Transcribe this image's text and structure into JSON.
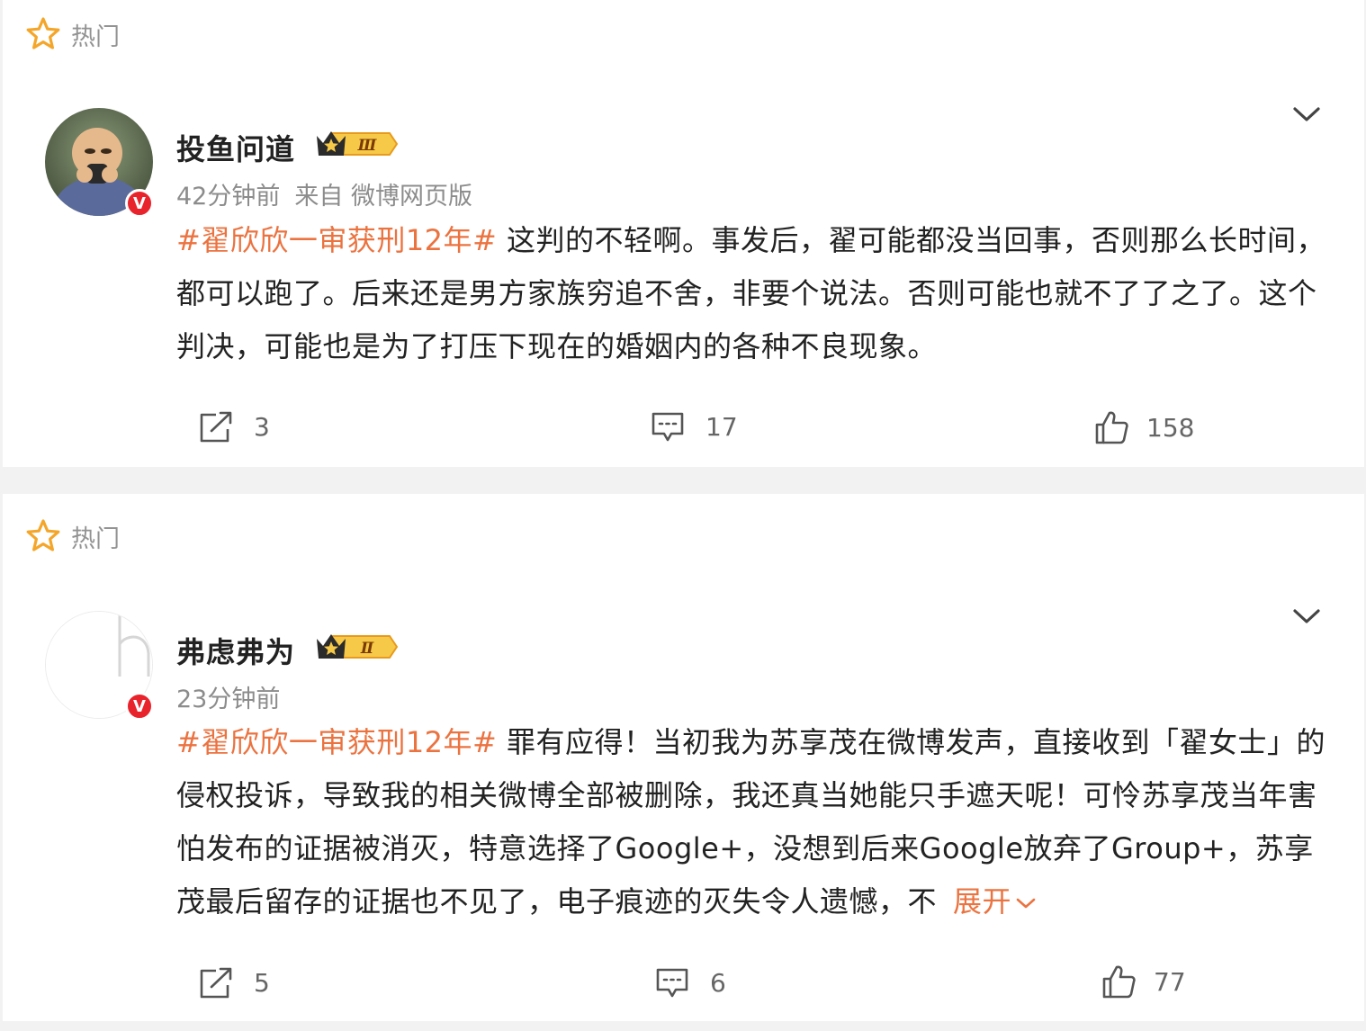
{
  "posts": [
    {
      "hot_label": "热门",
      "username": "投鱼问道",
      "rank": "Ⅲ",
      "time": "42分钟前",
      "source": "来自 微博网页版",
      "topic": "#翟欣欣一审获刑12年#",
      "body": " 这判的不轻啊。事发后，翟可能都没当回事，否则那么长时间，都可以跑了。后来还是男方家族穷追不舍，非要个说法。否则可能也就不了了之了。这个判决，可能也是为了打压下现在的婚姻内的各种不良现象。",
      "expand": "",
      "reposts": "3",
      "comments": "17",
      "likes": "158"
    },
    {
      "hot_label": "热门",
      "username": "弗虑弗为",
      "rank": "Ⅱ",
      "time": "23分钟前",
      "source": "",
      "topic": "#翟欣欣一审获刑12年#",
      "body": " 罪有应得！当初我为苏享茂在微博发声，直接收到「翟女士」的侵权投诉，导致我的相关微博全部被删除，我还真当她能只手遮天呢！可怜苏享茂当年害怕发布的证据被消灭，特意选择了Google+，没想到后来Google放弃了Group+，苏享茂最后留存的证据也不见了，电子痕迹的灭失令人遗憾，不",
      "expand": "展开",
      "reposts": "5",
      "comments": "6",
      "likes": "77"
    }
  ],
  "icons": {
    "hot": "star-outline-icon",
    "menu": "chevron-down-icon",
    "repost": "share-icon",
    "comment": "comment-icon",
    "like": "thumbs-up-icon"
  },
  "colors": {
    "topic": "#eb7340",
    "verified": "#e8232b",
    "meta": "#8c8c8c"
  }
}
